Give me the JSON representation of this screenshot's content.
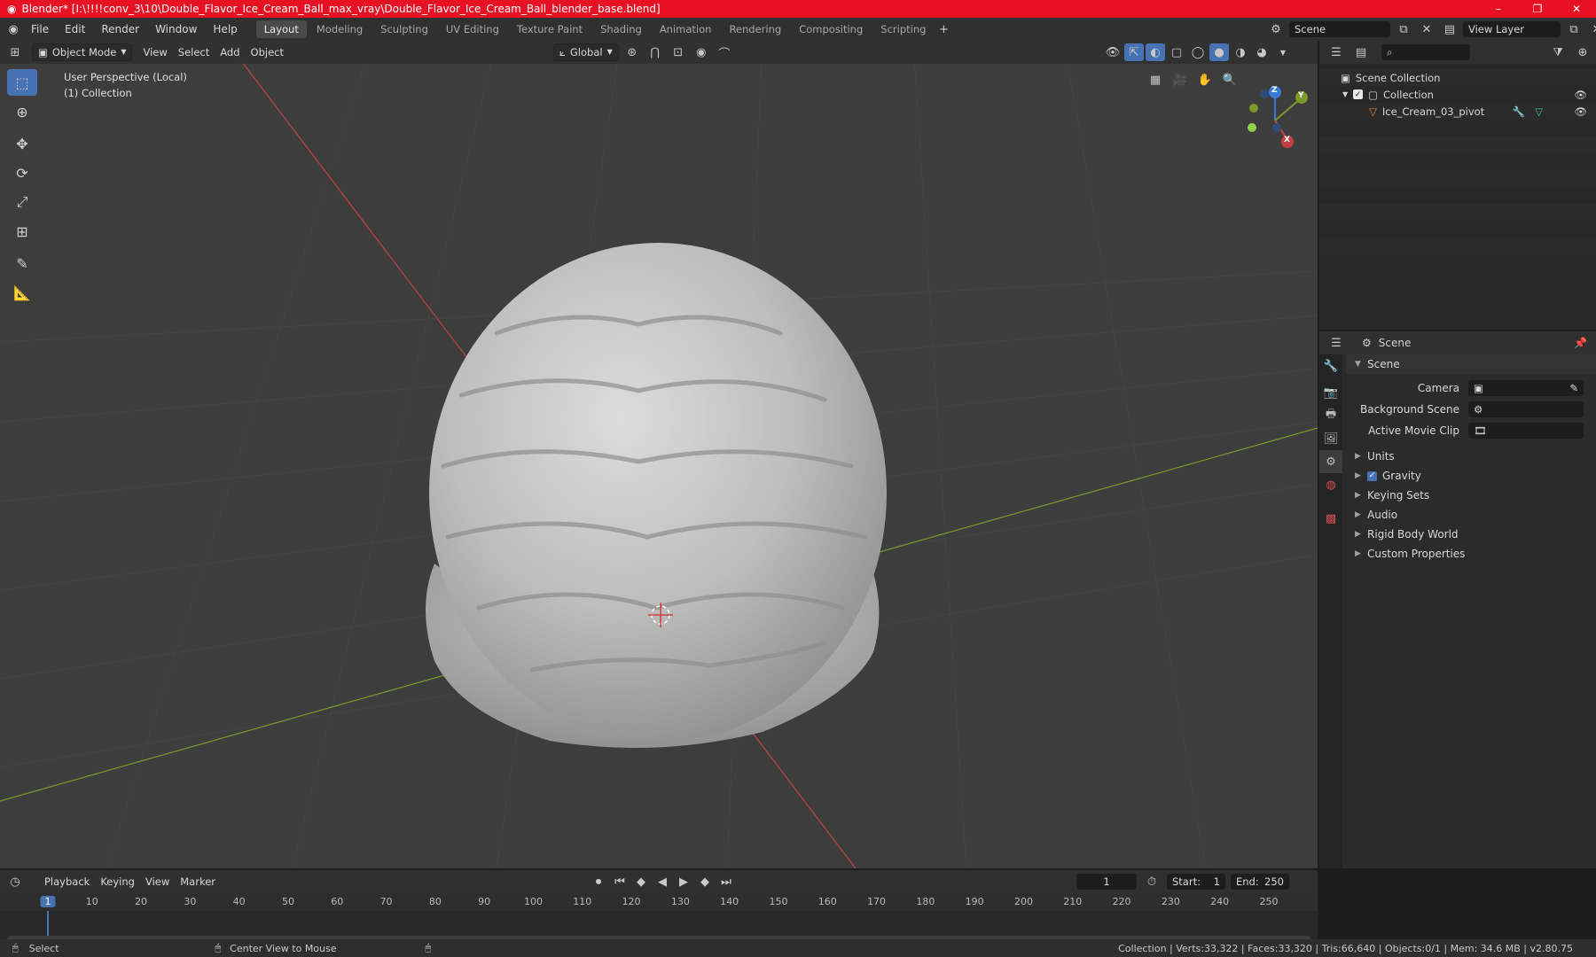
{
  "titlebar": {
    "title": "Blender* [I:\\!!!!conv_3\\10\\Double_Flavor_Ice_Cream_Ball_max_vray\\Double_Flavor_Ice_Cream_Ball_blender_base.blend]",
    "minimize": "–",
    "maximize": "❐",
    "close": "✕"
  },
  "menu": {
    "file": "File",
    "edit": "Edit",
    "render": "Render",
    "window": "Window",
    "help": "Help"
  },
  "workspaces": [
    "Layout",
    "Modeling",
    "Sculpting",
    "UV Editing",
    "Texture Paint",
    "Shading",
    "Animation",
    "Rendering",
    "Compositing",
    "Scripting"
  ],
  "scene_field": "Scene",
  "view_layer_field": "View Layer",
  "viewport": {
    "mode": "Object Mode",
    "view": "View",
    "select": "Select",
    "add": "Add",
    "object": "Object",
    "transform": "Global",
    "overlay_line1": "User Perspective (Local)",
    "overlay_line2": "(1) Collection",
    "gizmo": {
      "x": "X",
      "y": "Y",
      "z": "Z"
    }
  },
  "outliner": {
    "root": "Scene Collection",
    "collection": "Collection",
    "object": "Ice_Cream_03_pivot"
  },
  "properties": {
    "header": "Scene",
    "panel": "Scene",
    "camera_label": "Camera",
    "background_label": "Background Scene",
    "movie_clip_label": "Active Movie Clip",
    "sections": [
      "Units",
      "Gravity",
      "Keying Sets",
      "Audio",
      "Rigid Body World",
      "Custom Properties"
    ]
  },
  "timeline": {
    "playback": "Playback",
    "keying": "Keying",
    "view": "View",
    "marker": "Marker",
    "current_frame": "1",
    "start_label": "Start:",
    "start": "1",
    "end_label": "End:",
    "end": "250",
    "ticks": [
      "1",
      "10",
      "20",
      "30",
      "40",
      "50",
      "60",
      "70",
      "80",
      "90",
      "100",
      "110",
      "120",
      "130",
      "140",
      "150",
      "160",
      "170",
      "180",
      "190",
      "200",
      "210",
      "220",
      "230",
      "240",
      "250"
    ]
  },
  "status": {
    "select": "Select",
    "center": "Center View to Mouse",
    "stats": "Collection | Verts:33,322 | Faces:33,320 | Tris:66,640 | Objects:0/1 | Mem: 34.6 MB | v2.80.75"
  },
  "colors": {
    "titlebar": "#e81123",
    "accent": "#4772b3",
    "x_axis": "#c44040",
    "y_axis": "#7a9a2a",
    "z_axis": "#3a7ad8"
  }
}
